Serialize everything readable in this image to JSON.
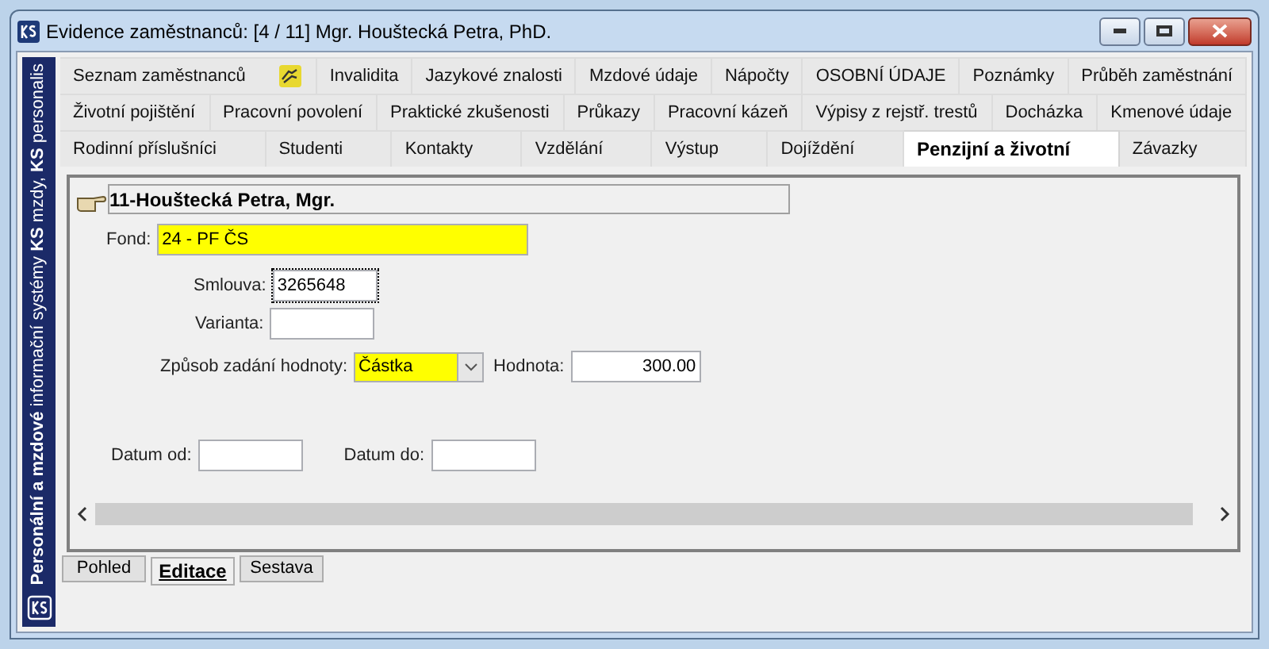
{
  "window": {
    "title": "Evidence zaměstnanců: [4 / 11] Mgr. Houštecká Petra, PhD."
  },
  "sidebar": {
    "text": "**Personální a mzdové** informační systémy **KS** mzdy, **KS** personalis"
  },
  "tab_rows": [
    [
      {
        "label": "Seznam zaměstnanců",
        "selected": false,
        "icon": true
      },
      {
        "label": "Invalidita",
        "selected": false
      },
      {
        "label": "Jazykové znalosti",
        "selected": false
      },
      {
        "label": "Mzdové údaje",
        "selected": false
      },
      {
        "label": "Nápočty",
        "selected": false
      },
      {
        "label": "OSOBNÍ ÚDAJE",
        "selected": false
      },
      {
        "label": "Poznámky",
        "selected": false
      },
      {
        "label": "Průběh zaměstnání",
        "selected": false
      }
    ],
    [
      {
        "label": "Životní pojištění",
        "selected": false
      },
      {
        "label": "Pracovní povolení",
        "selected": false
      },
      {
        "label": "Praktické zkušenosti",
        "selected": false
      },
      {
        "label": "Průkazy",
        "selected": false
      },
      {
        "label": "Pracovní kázeň",
        "selected": false
      },
      {
        "label": "Výpisy z rejstř. trestů",
        "selected": false
      },
      {
        "label": "Docházka",
        "selected": false
      },
      {
        "label": "Kmenové údaje",
        "selected": false
      }
    ],
    [
      {
        "label": "Rodinní příslušníci",
        "selected": false
      },
      {
        "label": "Studenti",
        "selected": false
      },
      {
        "label": "Kontakty",
        "selected": false
      },
      {
        "label": "Vzdělání",
        "selected": false
      },
      {
        "label": "Výstup",
        "selected": false
      },
      {
        "label": "Dojíždění",
        "selected": false
      },
      {
        "label": "Penzijní a životní",
        "selected": true
      },
      {
        "label": "Závazky",
        "selected": false
      }
    ]
  ],
  "record": {
    "title": "11-Houštecká Petra, Mgr."
  },
  "form": {
    "fond": {
      "label": "Fond:",
      "value": "24 - PF ČS"
    },
    "smlouva": {
      "label": "Smlouva:",
      "value": "3265648"
    },
    "varianta": {
      "label": "Varianta:"
    },
    "zpusob": {
      "label": "Způsob zadání hodnoty:",
      "value": "Částka"
    },
    "hodnota": {
      "label": "Hodnota:",
      "value": "300.00"
    },
    "datum_od": {
      "label": "Datum od:"
    },
    "datum_do": {
      "label": "Datum do:"
    }
  },
  "bottom_tabs": [
    {
      "label": "Pohled",
      "selected": false
    },
    {
      "label": "Editace",
      "selected": true
    },
    {
      "label": "Sestava",
      "selected": false
    }
  ]
}
